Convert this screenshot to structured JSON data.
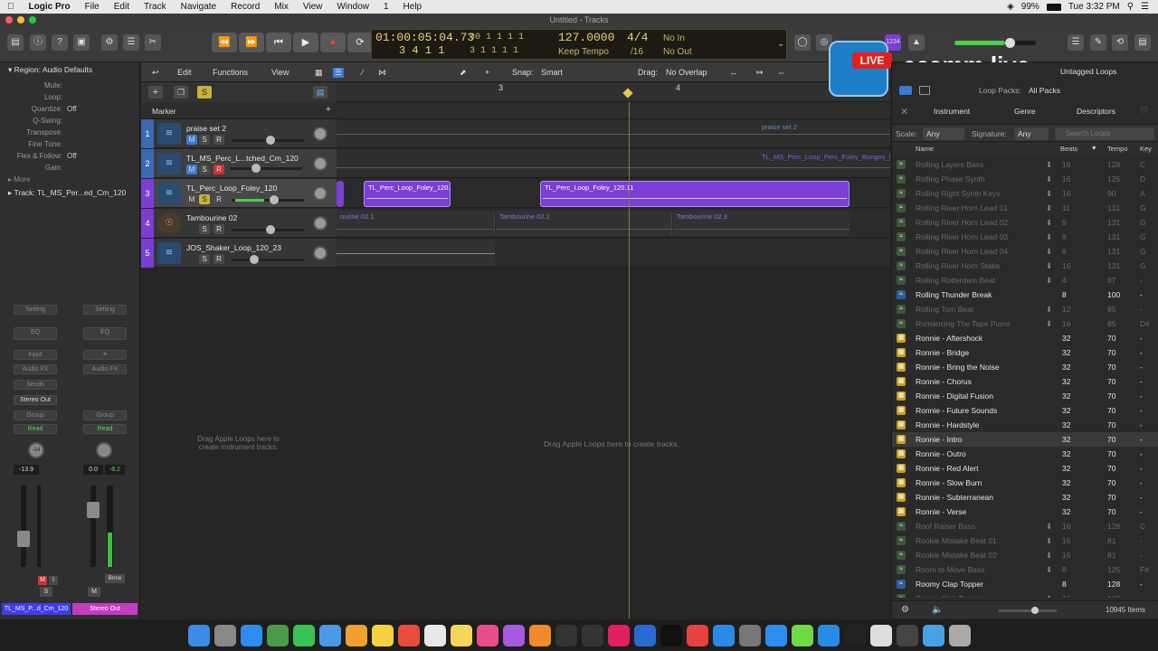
{
  "menubar": {
    "app": "Logic Pro",
    "items": [
      "File",
      "Edit",
      "Track",
      "Navigate",
      "Record",
      "Mix",
      "View",
      "Window",
      "1",
      "Help"
    ],
    "battery": "99%",
    "clock": "Tue 3:32 PM"
  },
  "window": {
    "title": "Untitled - Tracks"
  },
  "lcd": {
    "smpte": "01:00:05:04.73",
    "bars": "3  4  1    1",
    "smpte_sub": "00  1  1  1    1",
    "bars_sub": "3  1  1  1    1",
    "tempo": "127.0000",
    "tempo_mode": "Keep Tempo",
    "sig": "4/4",
    "div": "/16",
    "in": "No In",
    "out": "No Out"
  },
  "inspector": {
    "region_header": "Region: Audio Defaults",
    "rows": [
      {
        "k": "Mute:",
        "v": ""
      },
      {
        "k": "Loop:",
        "v": ""
      },
      {
        "k": "Quantize:",
        "v": "Off"
      },
      {
        "k": "Q-Swing:",
        "v": ""
      },
      {
        "k": "Transpose:",
        "v": ""
      },
      {
        "k": "Fine Tune:",
        "v": ""
      },
      {
        "k": "Flex & Follow:",
        "v": "Off"
      },
      {
        "k": "Gain:",
        "v": ""
      }
    ],
    "more": "More",
    "track_header": "Track:  TL_MS_Per...ed_Cm_120",
    "strip1": {
      "setting": "Setting",
      "eq": "EQ",
      "input": "Input",
      "audiofx": "Audio FX",
      "sends": "Sends",
      "out": "Stereo Out",
      "group": "Group",
      "auto": "Read",
      "pan": "-14",
      "vol": "-13.9",
      "name": "TL_MS_P...d_Cm_120"
    },
    "strip2": {
      "setting": "Setting",
      "eq": "EQ",
      "audiofx": "Audio FX",
      "group": "Group",
      "auto": "Read",
      "vol": "0.0",
      "peak": "-8.2",
      "bnce": "Bnce",
      "name": "Stereo Out"
    },
    "s": "S",
    "m": "M",
    "i": "I"
  },
  "toolbar": {
    "edit": "Edit",
    "functions": "Functions",
    "view": "View",
    "snap_label": "Snap:",
    "snap": "Smart",
    "drag_label": "Drag:",
    "drag": "No Overlap"
  },
  "ruler": {
    "m3": "3",
    "m4": "4"
  },
  "marker": "Marker",
  "tracks": [
    {
      "num": "1",
      "name": "praise set 2",
      "m": "M",
      "s": "S",
      "r": "R"
    },
    {
      "num": "2",
      "name": "TL_MS_Perc_L...tched_Cm_120",
      "m": "M",
      "s": "S",
      "r": "R"
    },
    {
      "num": "3",
      "name": "TL_Perc_Loop_Foley_120",
      "m": "M",
      "s": "S",
      "r": "R"
    },
    {
      "num": "4",
      "name": "Tambourine 02",
      "m": "",
      "s": "S",
      "r": "R"
    },
    {
      "num": "5",
      "name": "JOS_Shaker_Loop_120_23",
      "m": "",
      "s": "S",
      "r": "R"
    }
  ],
  "regions": {
    "praise": "praise set 2",
    "perc2": "TL_MS_Perc_Loop_Perc_Foley_Bongos_I",
    "foley8": "TL_Perc_Loop_Foley_120.8",
    "foley11": "TL_Perc_Loop_Foley_120.11",
    "tamb1": "ourine 02.1",
    "tamb2": "Tambourine 02.2",
    "tamb3": "Tambourine 02.3"
  },
  "drop": {
    "headers": "Drag Apple Loops here to create instrument tracks.",
    "lanes": "Drag Apple Loops here to create tracks."
  },
  "ecamm": {
    "live": "LIVE",
    "brand": "ecamm.live"
  },
  "browser": {
    "title": "Untagged Loops",
    "packs_label": "Loop Packs:",
    "packs": "All Packs",
    "tabs": [
      "Instrument",
      "Genre",
      "Descriptors"
    ],
    "scale_label": "Scale:",
    "scale": "Any",
    "sig_label": "Signature:",
    "sig": "Any",
    "search": "Search Loops",
    "cols": [
      "Name",
      "Beats",
      "Tempo",
      "Key"
    ],
    "count": "10945 Items",
    "loops": [
      [
        "Rolling Layers Bass",
        "16",
        "128",
        "C",
        1
      ],
      [
        "Rolling Phase Synth",
        "16",
        "125",
        "D",
        1
      ],
      [
        "Rolling Right Synth Keys",
        "16",
        "90",
        "A",
        1
      ],
      [
        "Rolling River Horn Lead 01",
        "11",
        "131",
        "G",
        1
      ],
      [
        "Rolling River Horn Lead 02",
        "9",
        "131",
        "G",
        1
      ],
      [
        "Rolling River Horn Lead 03",
        "8",
        "131",
        "G",
        1
      ],
      [
        "Rolling River Horn Lead 04",
        "8",
        "131",
        "G",
        1
      ],
      [
        "Rolling River Horn Stabs",
        "16",
        "131",
        "G",
        1
      ],
      [
        "Rolling Rotterdam Beat",
        "4",
        "87",
        "-",
        1
      ],
      [
        "Rolling Thunder Break",
        "8",
        "100",
        "-",
        0
      ],
      [
        "Rolling Tom Beat",
        "12",
        "85",
        "-",
        1
      ],
      [
        "Romancing The Tape Piano",
        "16",
        "85",
        "D#",
        1
      ],
      [
        "Ronnie - Aftershock",
        "32",
        "70",
        "-",
        0
      ],
      [
        "Ronnie - Bridge",
        "32",
        "70",
        "-",
        0
      ],
      [
        "Ronnie - Bring the Noise",
        "32",
        "70",
        "-",
        0
      ],
      [
        "Ronnie - Chorus",
        "32",
        "70",
        "-",
        0
      ],
      [
        "Ronnie - Digital Fusion",
        "32",
        "70",
        "-",
        0
      ],
      [
        "Ronnie - Future Sounds",
        "32",
        "70",
        "-",
        0
      ],
      [
        "Ronnie - Hardstyle",
        "32",
        "70",
        "-",
        0
      ],
      [
        "Ronnie - Intro",
        "32",
        "70",
        "-",
        0
      ],
      [
        "Ronnie - Outro",
        "32",
        "70",
        "-",
        0
      ],
      [
        "Ronnie - Red Alert",
        "32",
        "70",
        "-",
        0
      ],
      [
        "Ronnie - Slow Burn",
        "32",
        "70",
        "-",
        0
      ],
      [
        "Ronnie - Subterranean",
        "32",
        "70",
        "-",
        0
      ],
      [
        "Ronnie - Verse",
        "32",
        "70",
        "-",
        0
      ],
      [
        "Roof Raiser Bass",
        "16",
        "128",
        "C",
        1
      ],
      [
        "Rookie Mistake Beat 01",
        "16",
        "81",
        "-",
        1
      ],
      [
        "Rookie Mistake Beat 02",
        "16",
        "81",
        "-",
        1
      ],
      [
        "Room to Move Bass",
        "8",
        "125",
        "F#",
        1
      ],
      [
        "Roomy Clap Topper",
        "8",
        "128",
        "-",
        0
      ],
      [
        "Roomy Kick Topper",
        "16",
        "140",
        "-",
        1
      ]
    ]
  },
  "dock": [
    "Finder",
    "Launchpad",
    "Safari",
    "Preview",
    "Messages",
    "Mail",
    "Photos",
    "Notes",
    "Calendar",
    "Reminders",
    "Notes2",
    "iTunes",
    "Podcasts",
    "Books",
    "Logic",
    "Final Cut",
    "muse",
    "ecamm",
    "TV",
    "News",
    "App Store",
    "System Preferences",
    "Zoom",
    "Upwork",
    "Mail2",
    "Terminal",
    "Script",
    "Ableton",
    "Folder",
    "Trash"
  ],
  "colors": {
    "region_purple": "#7b3fd4",
    "region_gray": "#4a4a4a",
    "accent_yellow": "#e6c84a"
  }
}
